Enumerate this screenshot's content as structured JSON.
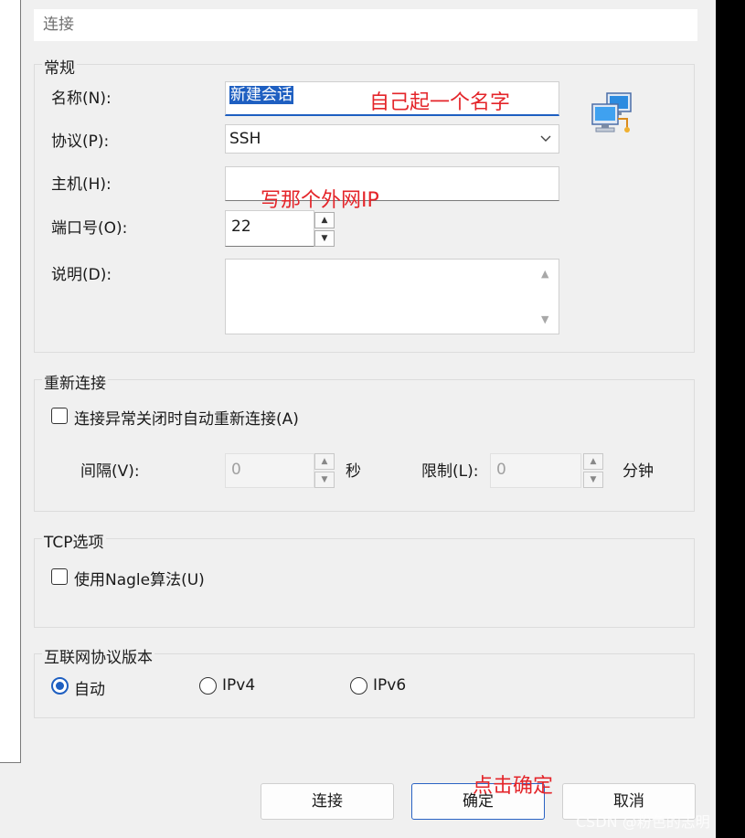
{
  "header": {
    "title": "连接"
  },
  "general": {
    "title": "常规",
    "name_label": "名称(N):",
    "name_value": "新建会话",
    "protocol_label": "协议(P):",
    "protocol_value": "SSH",
    "host_label": "主机(H):",
    "host_value": "",
    "port_label": "端口号(O):",
    "port_value": "22",
    "desc_label": "说明(D):",
    "desc_value": ""
  },
  "reconnect": {
    "title": "重新连接",
    "auto_checkbox_label": "连接异常关闭时自动重新连接(A)",
    "auto_checked": false,
    "interval_label": "间隔(V):",
    "interval_value": "0",
    "interval_unit": "秒",
    "limit_label": "限制(L):",
    "limit_value": "0",
    "limit_unit": "分钟"
  },
  "tcp": {
    "title": "TCP选项",
    "nagle_label": "使用Nagle算法(U)",
    "nagle_checked": false
  },
  "ip_version": {
    "title": "互联网协议版本",
    "options": [
      {
        "label": "自动",
        "selected": true
      },
      {
        "label": "IPv4",
        "selected": false
      },
      {
        "label": "IPv6",
        "selected": false
      }
    ]
  },
  "buttons": {
    "connect": "连接",
    "ok": "确定",
    "cancel": "取消"
  },
  "annotations": {
    "name_hint": "自己起一个名字",
    "host_hint": "写那个外网IP",
    "ok_hint": "点击确定"
  },
  "watermark": "CSDN @粉色的志明",
  "icons": {
    "session_icon": "network-computers-icon",
    "combo_arrow": "chevron-down-icon",
    "spin_up": "spin-up-icon",
    "spin_down": "spin-down-icon"
  },
  "colors": {
    "accent": "#1e5fc1",
    "annotation": "#e4252a",
    "dialog_bg": "#f0f0f0"
  }
}
